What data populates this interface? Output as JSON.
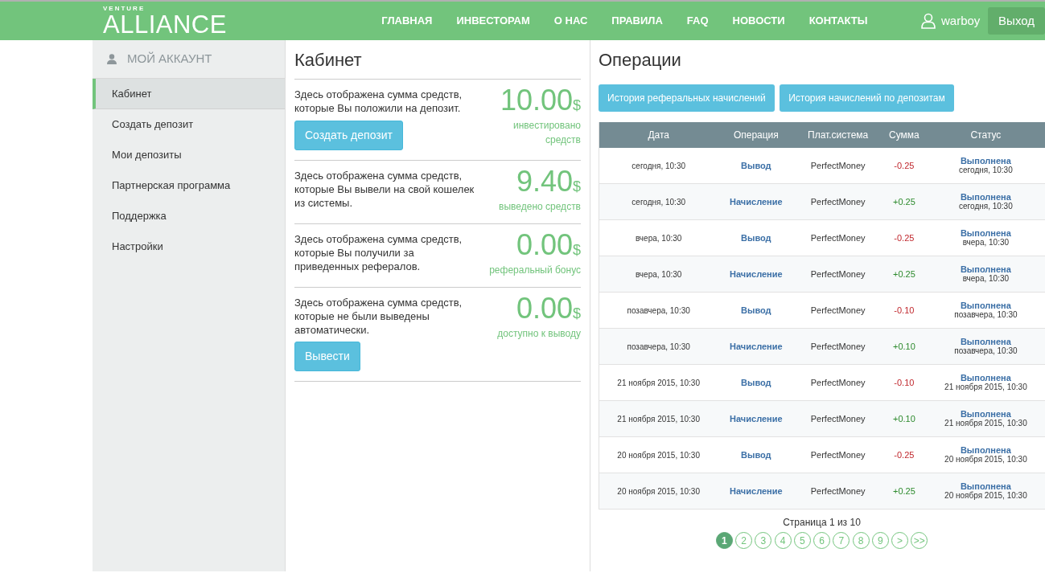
{
  "brand": {
    "top": "VENTURE",
    "main": "ALLIANCE"
  },
  "nav": [
    {
      "label": "ГЛАВНАЯ"
    },
    {
      "label": "ИНВЕСТОРАМ"
    },
    {
      "label": "О НАС"
    },
    {
      "label": "ПРАВИЛА"
    },
    {
      "label": "FAQ"
    },
    {
      "label": "НОВОСТИ"
    },
    {
      "label": "КОНТАКТЫ"
    }
  ],
  "user": {
    "name": "warboy",
    "logout": "Выход"
  },
  "sidebar": {
    "title": "МОЙ АККАУНТ",
    "items": [
      {
        "label": "Кабинет",
        "selected": true
      },
      {
        "label": "Создать депозит",
        "selected": false
      },
      {
        "label": "Мои депозиты",
        "selected": false
      },
      {
        "label": "Партнерская программа",
        "selected": false
      },
      {
        "label": "Поддержка",
        "selected": false
      },
      {
        "label": "Настройки",
        "selected": false
      }
    ]
  },
  "cabinet": {
    "title": "Кабинет",
    "stats": [
      {
        "description": "Здесь отображена сумма средств, которые Вы положили на депозит.",
        "amount": "10.00",
        "currency": "$",
        "label": "инвестировано средств",
        "button": "Создать депозит"
      },
      {
        "description": "Здесь отображена сумма средств, которые Вы вывели на свой кошелек из системы.",
        "amount": "9.40",
        "currency": "$",
        "label": "выведено средств"
      },
      {
        "description": "Здесь отображена сумма средств, которые Вы получили за приведенных рефералов.",
        "amount": "0.00",
        "currency": "$",
        "label": "реферальный бонус"
      },
      {
        "description": "Здесь отображена сумма средств, которые не были выведены автоматически.",
        "amount": "0.00",
        "currency": "$",
        "label": "доступно к выводу",
        "button": "Вывести"
      }
    ]
  },
  "operations": {
    "title": "Операции",
    "buttons": [
      "История реферальных начислений",
      "История начислений по депозитам"
    ],
    "table": {
      "columns": [
        "Дата",
        "Операция",
        "Плат.система",
        "Сумма",
        "Статус"
      ],
      "rows": [
        {
          "kind": "debit",
          "date": "сегодня, 10:30",
          "operation": "Вывод",
          "system": "PerfectMoney",
          "amount": "-0.25",
          "status": "Выполнена",
          "status_time": "сегодня, 10:30"
        },
        {
          "kind": "credit",
          "date": "сегодня, 10:30",
          "operation": "Начисление",
          "system": "PerfectMoney",
          "amount": "+0.25",
          "status": "Выполнена",
          "status_time": "сегодня, 10:30"
        },
        {
          "kind": "debit",
          "date": "вчера, 10:30",
          "operation": "Вывод",
          "system": "PerfectMoney",
          "amount": "-0.25",
          "status": "Выполнена",
          "status_time": "вчера, 10:30"
        },
        {
          "kind": "credit",
          "date": "вчера, 10:30",
          "operation": "Начисление",
          "system": "PerfectMoney",
          "amount": "+0.25",
          "status": "Выполнена",
          "status_time": "вчера, 10:30"
        },
        {
          "kind": "debit",
          "date": "позавчера, 10:30",
          "operation": "Вывод",
          "system": "PerfectMoney",
          "amount": "-0.10",
          "status": "Выполнена",
          "status_time": "позавчера, 10:30"
        },
        {
          "kind": "credit",
          "date": "позавчера, 10:30",
          "operation": "Начисление",
          "system": "PerfectMoney",
          "amount": "+0.10",
          "status": "Выполнена",
          "status_time": "позавчера, 10:30"
        },
        {
          "kind": "debit",
          "date": "21 ноября 2015, 10:30",
          "operation": "Вывод",
          "system": "PerfectMoney",
          "amount": "-0.10",
          "status": "Выполнена",
          "status_time": "21 ноября 2015, 10:30"
        },
        {
          "kind": "credit",
          "date": "21 ноября 2015, 10:30",
          "operation": "Начисление",
          "system": "PerfectMoney",
          "amount": "+0.10",
          "status": "Выполнена",
          "status_time": "21 ноября 2015, 10:30"
        },
        {
          "kind": "debit",
          "date": "20 ноября 2015, 10:30",
          "operation": "Вывод",
          "system": "PerfectMoney",
          "amount": "-0.25",
          "status": "Выполнена",
          "status_time": "20 ноября 2015, 10:30"
        },
        {
          "kind": "credit",
          "date": "20 ноября 2015, 10:30",
          "operation": "Начисление",
          "system": "PerfectMoney",
          "amount": "+0.25",
          "status": "Выполнена",
          "status_time": "20 ноября 2015, 10:30"
        }
      ]
    },
    "page_info": "Страница 1 из 10",
    "pages": [
      {
        "label": "1",
        "selected": true
      },
      {
        "label": "2",
        "selected": false
      },
      {
        "label": "3",
        "selected": false
      },
      {
        "label": "4",
        "selected": false
      },
      {
        "label": "5",
        "selected": false
      },
      {
        "label": "6",
        "selected": false
      },
      {
        "label": "7",
        "selected": false
      },
      {
        "label": "8",
        "selected": false
      },
      {
        "label": "9",
        "selected": false
      },
      {
        "label": ">",
        "selected": false
      },
      {
        "label": ">>",
        "selected": false
      }
    ]
  }
}
